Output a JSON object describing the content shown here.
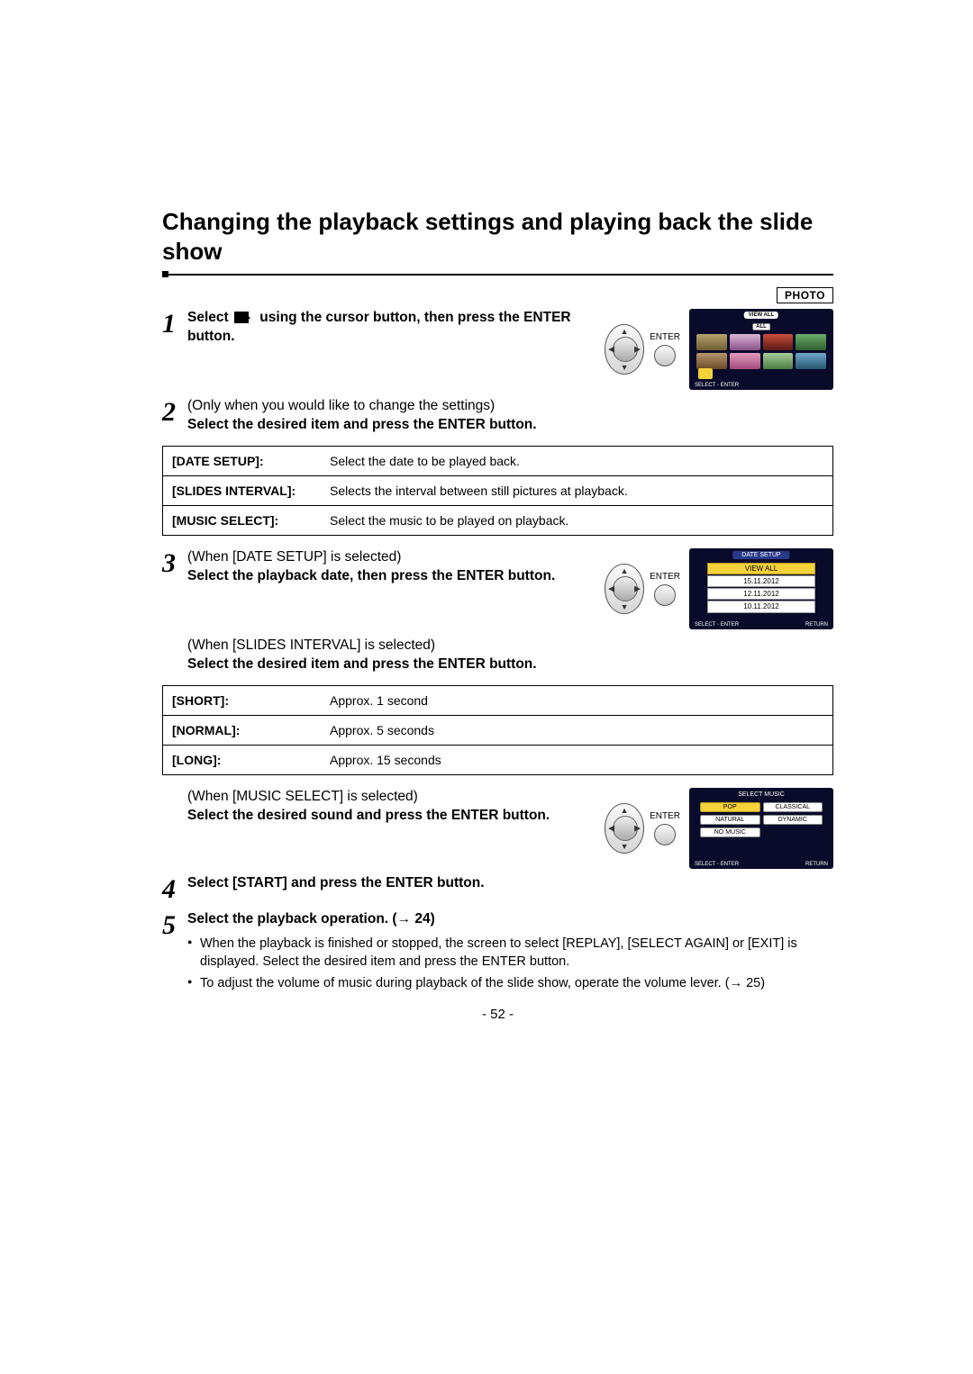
{
  "title": "Changing the playback settings and playing back the slide show",
  "badge": "PHOTO",
  "enter_label": "ENTER",
  "steps": {
    "s1": {
      "num": "1",
      "pre": "Select",
      "post": "using the cursor button, then press the ENTER button."
    },
    "s2": {
      "num": "2",
      "paren": "(Only when you would like to change the settings)",
      "bold": "Select the desired item and press the ENTER button."
    },
    "s3": {
      "num": "3",
      "paren": "(When [DATE SETUP] is selected)",
      "bold": "Select the playback date, then press the ENTER button.",
      "paren2": "(When [SLIDES INTERVAL] is selected)",
      "bold2": "Select the desired item and press the ENTER button.",
      "paren3": "(When [MUSIC SELECT] is selected)",
      "bold3": "Select the desired sound and press the ENTER button."
    },
    "s4": {
      "num": "4",
      "bold": "Select [START] and press the ENTER button."
    },
    "s5": {
      "num": "5",
      "bold_pre": "Select the playback operation. (",
      "arrow": "→",
      "page_ref": "24",
      "bold_post": ")"
    }
  },
  "settings_table": [
    {
      "label": "[DATE SETUP]:",
      "desc": "Select the date to be played back."
    },
    {
      "label": "[SLIDES INTERVAL]:",
      "desc": "Selects the interval between still pictures at playback."
    },
    {
      "label": "[MUSIC SELECT]:",
      "desc": "Select the music to be played on playback."
    }
  ],
  "interval_table": [
    {
      "label": "[SHORT]:",
      "desc": "Approx. 1 second"
    },
    {
      "label": "[NORMAL]:",
      "desc": "Approx. 5 seconds"
    },
    {
      "label": "[LONG]:",
      "desc": "Approx. 15 seconds"
    }
  ],
  "lcd_viewall": {
    "top_btn": "VIEW ALL",
    "all": "ALL",
    "footer_left": "SELECT",
    "footer_mid": "ENTER"
  },
  "lcd_date": {
    "title": "DATE SETUP",
    "items": [
      "VIEW ALL",
      "15.11.2012",
      "12.11.2012",
      "10.11.2012"
    ],
    "footer_left": "SELECT",
    "footer_mid": "ENTER",
    "footer_right": "RETURN"
  },
  "lcd_music": {
    "title": "SELECT MUSIC",
    "items": [
      "POP",
      "CLASSICAL",
      "NATURAL",
      "DYNAMIC",
      "NO MUSIC"
    ],
    "footer_left": "SELECT",
    "footer_mid": "ENTER",
    "footer_right": "RETURN"
  },
  "bullets": [
    "When the playback is finished or stopped, the screen to select [REPLAY], [SELECT AGAIN] or [EXIT] is displayed. Select the desired item and press the ENTER button.",
    "To adjust the volume of music during playback of the slide show, operate the volume lever. (→ 25)"
  ],
  "page_number": "- 52 -"
}
